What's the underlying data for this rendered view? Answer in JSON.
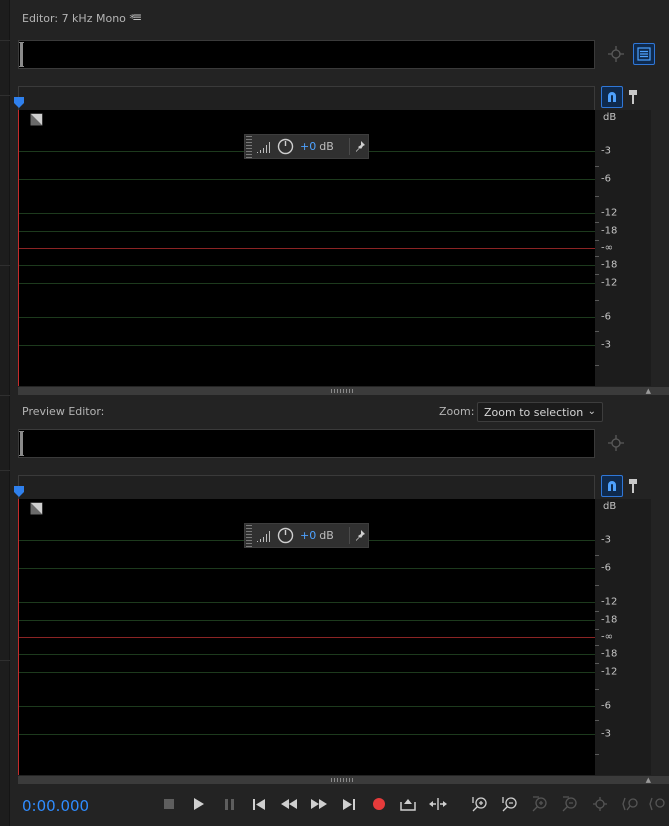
{
  "editor": {
    "title": "Editor: 7 kHz Mono *",
    "menu_icon": "hamburger-menu-icon"
  },
  "preview": {
    "title": "Preview Editor:",
    "zoom_label": "Zoom:",
    "zoom_value": "Zoom to selection"
  },
  "hud": {
    "value": "+0",
    "unit": "dB"
  },
  "ruler": {
    "unit": "dB",
    "labels": [
      "-3",
      "-6",
      "-12",
      "-18",
      "-∞",
      "-18",
      "-12",
      "-6",
      "-3"
    ]
  },
  "transport": {
    "time": "0:00.000",
    "buttons": [
      "stop",
      "play",
      "pause",
      "skip-to-start",
      "rewind",
      "fast-forward",
      "skip-to-end",
      "record",
      "skip-selection",
      "loop"
    ]
  },
  "colors": {
    "accent": "#2f8cff",
    "record": "#e63b3b",
    "background": "#232323"
  }
}
